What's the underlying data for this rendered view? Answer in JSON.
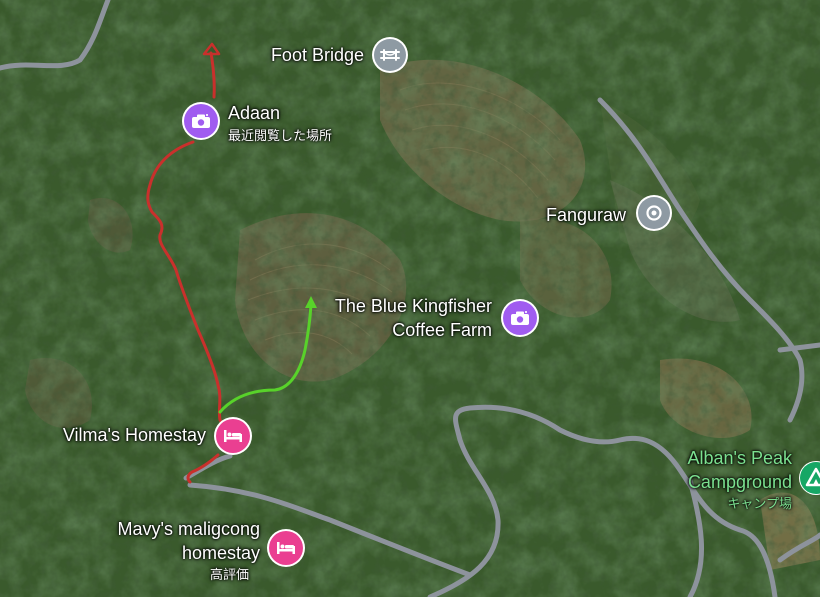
{
  "places": {
    "foot_bridge": {
      "name": "Foot Bridge"
    },
    "adaan": {
      "name": "Adaan",
      "note": "最近閲覧した場所"
    },
    "fanguraw": {
      "name": "Fanguraw"
    },
    "blue_kingfisher": {
      "line1": "The Blue Kingfisher",
      "line2": "Coffee Farm"
    },
    "vilmas_homestay": {
      "name": "Vilma's Homestay"
    },
    "mavys": {
      "line1": "Mavy's maligcong",
      "line2": "homestay",
      "note": "高評価"
    },
    "albans_peak": {
      "line1": "Alban's Peak",
      "line2": "Campground",
      "note": "キャンプ場"
    }
  },
  "colors": {
    "route_red": "#c9302c",
    "route_green": "#58d22a",
    "road": "#8d939c",
    "photo_pin": "#a05cf0",
    "hotel_pin": "#ea3f91",
    "gray_pin": "#8e9aa3",
    "campground_green": "#16a765"
  },
  "icons": {
    "foot_bridge": "bridge-icon",
    "adaan": "camera-icon",
    "fanguraw": "location-dot-icon",
    "blue_kingfisher": "camera-icon",
    "vilmas_homestay": "bed-icon",
    "mavys": "bed-icon",
    "albans_peak": "campground-icon"
  }
}
